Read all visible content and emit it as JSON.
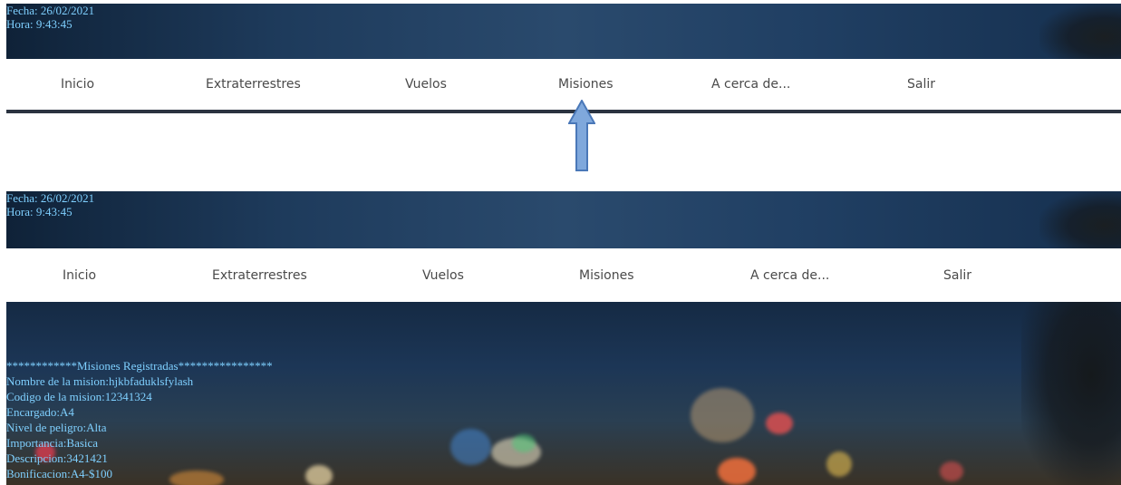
{
  "top": {
    "date": "Fecha: 26/02/2021",
    "time": "Hora: 9:43:45",
    "nav": [
      "Inicio",
      "Extraterrestres",
      "Vuelos",
      "Misiones",
      "A cerca de...",
      "Salir"
    ]
  },
  "bottom": {
    "date": "Fecha: 26/02/2021",
    "time": "Hora: 9:43:45",
    "nav": [
      "Inicio",
      "Extraterrestres",
      "Vuelos",
      "Misiones",
      "A cerca de...",
      "Salir"
    ],
    "mission": {
      "header": "************Misiones Registradas****************",
      "name": "Nombre de la mision:hjkbfaduklsfylash",
      "code": "Codigo de la mision:12341324",
      "manager": "Encargado:A4",
      "danger": "Nivel de peligro:Alta",
      "importance": "Importancia:Basica",
      "description": "Descripcion:3421421",
      "bonus": "Bonificacion:A4-$100"
    }
  },
  "annotation": {
    "arrow_icon": "up-arrow-icon",
    "arrow_color": "#7fa8dc"
  }
}
